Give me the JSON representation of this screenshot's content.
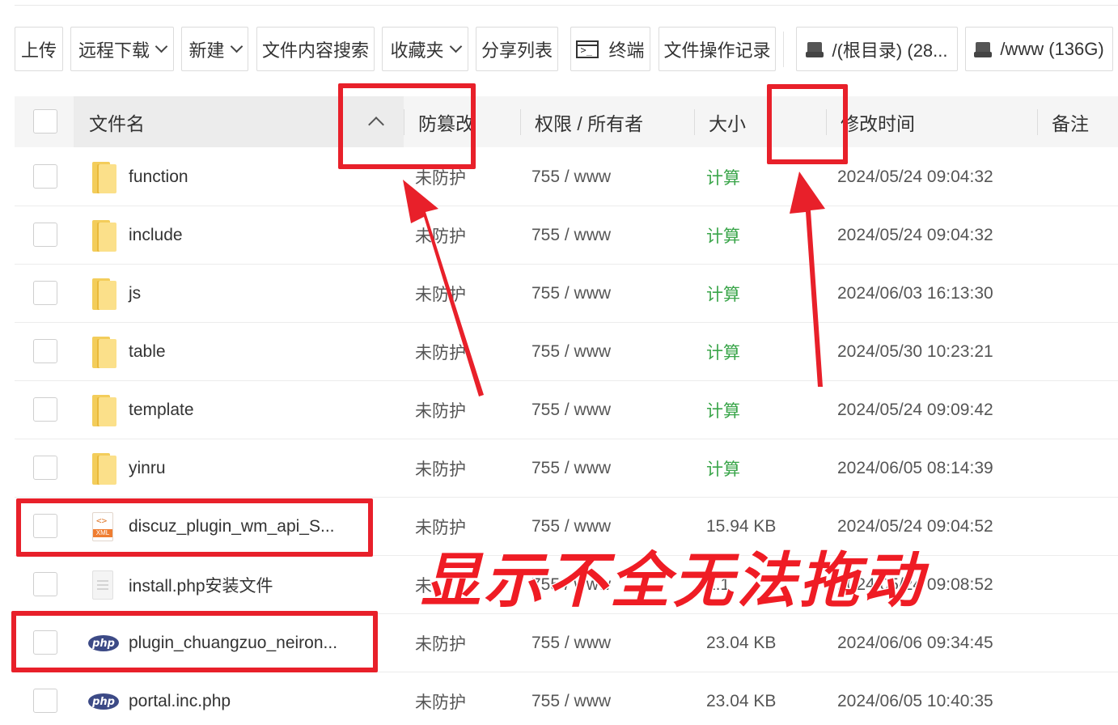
{
  "toolbar": {
    "upload": "上传",
    "remote_download": "远程下载",
    "new": "新建",
    "content_search": "文件内容搜索",
    "favorites": "收藏夹",
    "share_list": "分享列表",
    "terminal": "终端",
    "op_log": "文件操作记录",
    "disk_root": "/(根目录) (28...",
    "disk_www": "/www (136G)"
  },
  "table": {
    "headers": {
      "name": "文件名",
      "tamper": "防篡改",
      "perm": "权限 / 所有者",
      "size": "大小",
      "mtime": "修改时间",
      "note": "备注"
    },
    "rows": [
      {
        "type": "folder",
        "name": "function",
        "tamper": "未防护",
        "perm": "755 / www",
        "size": "计算",
        "mtime": "2024/05/24 09:04:32"
      },
      {
        "type": "folder",
        "name": "include",
        "tamper": "未防护",
        "perm": "755 / www",
        "size": "计算",
        "mtime": "2024/05/24 09:04:32"
      },
      {
        "type": "folder",
        "name": "js",
        "tamper": "未防护",
        "perm": "755 / www",
        "size": "计算",
        "mtime": "2024/06/03 16:13:30"
      },
      {
        "type": "folder",
        "name": "table",
        "tamper": "未防护",
        "perm": "755 / www",
        "size": "计算",
        "mtime": "2024/05/30 10:23:21"
      },
      {
        "type": "folder",
        "name": "template",
        "tamper": "未防护",
        "perm": "755 / www",
        "size": "计算",
        "mtime": "2024/05/24 09:09:42"
      },
      {
        "type": "folder",
        "name": "yinru",
        "tamper": "未防护",
        "perm": "755 / www",
        "size": "计算",
        "mtime": "2024/06/05 08:14:39"
      },
      {
        "type": "xml",
        "name": "discuz_plugin_wm_api_S...",
        "tamper": "未防护",
        "perm": "755 / www",
        "size": "15.94 KB",
        "mtime": "2024/05/24 09:04:52"
      },
      {
        "type": "txt",
        "name": "install.php安装文件",
        "tamper": "未",
        "perm": "755 / www",
        "size": "1.1",
        "mtime": "2024/05/24 09:08:52"
      },
      {
        "type": "php",
        "name": "plugin_chuangzuo_neiron...",
        "tamper": "未防护",
        "perm": "755 / www",
        "size": "23.04 KB",
        "mtime": "2024/06/06 09:34:45"
      },
      {
        "type": "php",
        "name": "portal.inc.php",
        "tamper": "未防护",
        "perm": "755 / www",
        "size": "23.04 KB",
        "mtime": "2024/06/05 10:40:35"
      }
    ]
  },
  "icons": {
    "xml_code": "<>",
    "xml_tag": "XML",
    "php": "php"
  },
  "annotation": {
    "caption": "显示不全无法拖动",
    "color": "#e8202a"
  }
}
